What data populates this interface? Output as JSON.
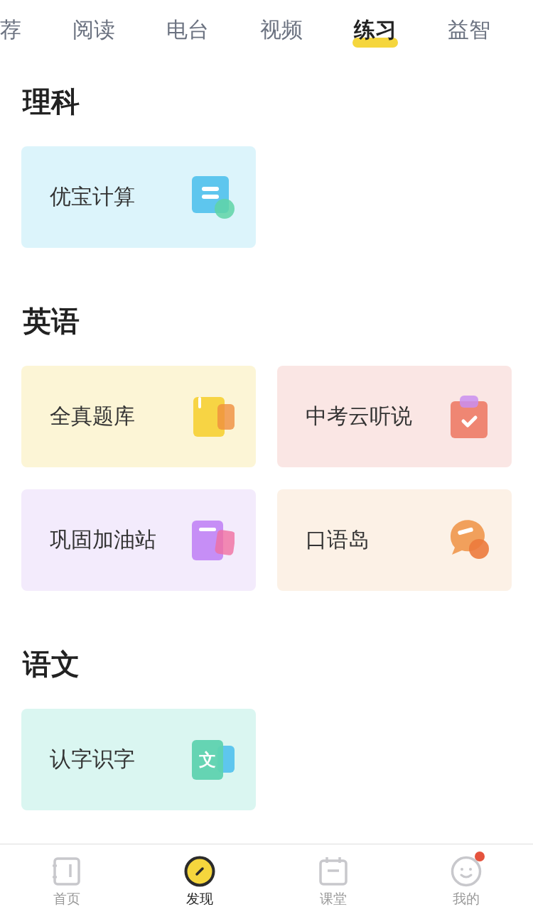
{
  "tabs": [
    {
      "label": "荐",
      "selected": false
    },
    {
      "label": "阅读",
      "selected": false
    },
    {
      "label": "电台",
      "selected": false
    },
    {
      "label": "视频",
      "selected": false
    },
    {
      "label": "练习",
      "selected": true
    },
    {
      "label": "益智",
      "selected": false
    }
  ],
  "sections": [
    {
      "title": "理科",
      "cards": [
        {
          "label": "优宝计算",
          "kind": "calc",
          "color": "#dcf4fb"
        }
      ]
    },
    {
      "title": "英语",
      "cards": [
        {
          "label": "全真题库",
          "kind": "book",
          "color": "#fcf5d6"
        },
        {
          "label": "中考云听说",
          "kind": "clipboard",
          "color": "#fae6e4"
        },
        {
          "label": "巩固加油站",
          "kind": "notebook",
          "color": "#f3ebfc"
        },
        {
          "label": "口语岛",
          "kind": "chat",
          "color": "#fcf1e6"
        }
      ]
    },
    {
      "title": "语文",
      "cards": [
        {
          "label": "认字识字",
          "kind": "glyph",
          "glyph": "文",
          "color": "#daf6f1"
        }
      ]
    }
  ],
  "nav": [
    {
      "label": "首页",
      "kind": "home",
      "selected": false,
      "badge": false
    },
    {
      "label": "发现",
      "kind": "discover",
      "selected": true,
      "badge": false
    },
    {
      "label": "课堂",
      "kind": "calendar",
      "selected": false,
      "badge": false
    },
    {
      "label": "我的",
      "kind": "face",
      "selected": false,
      "badge": true
    }
  ]
}
